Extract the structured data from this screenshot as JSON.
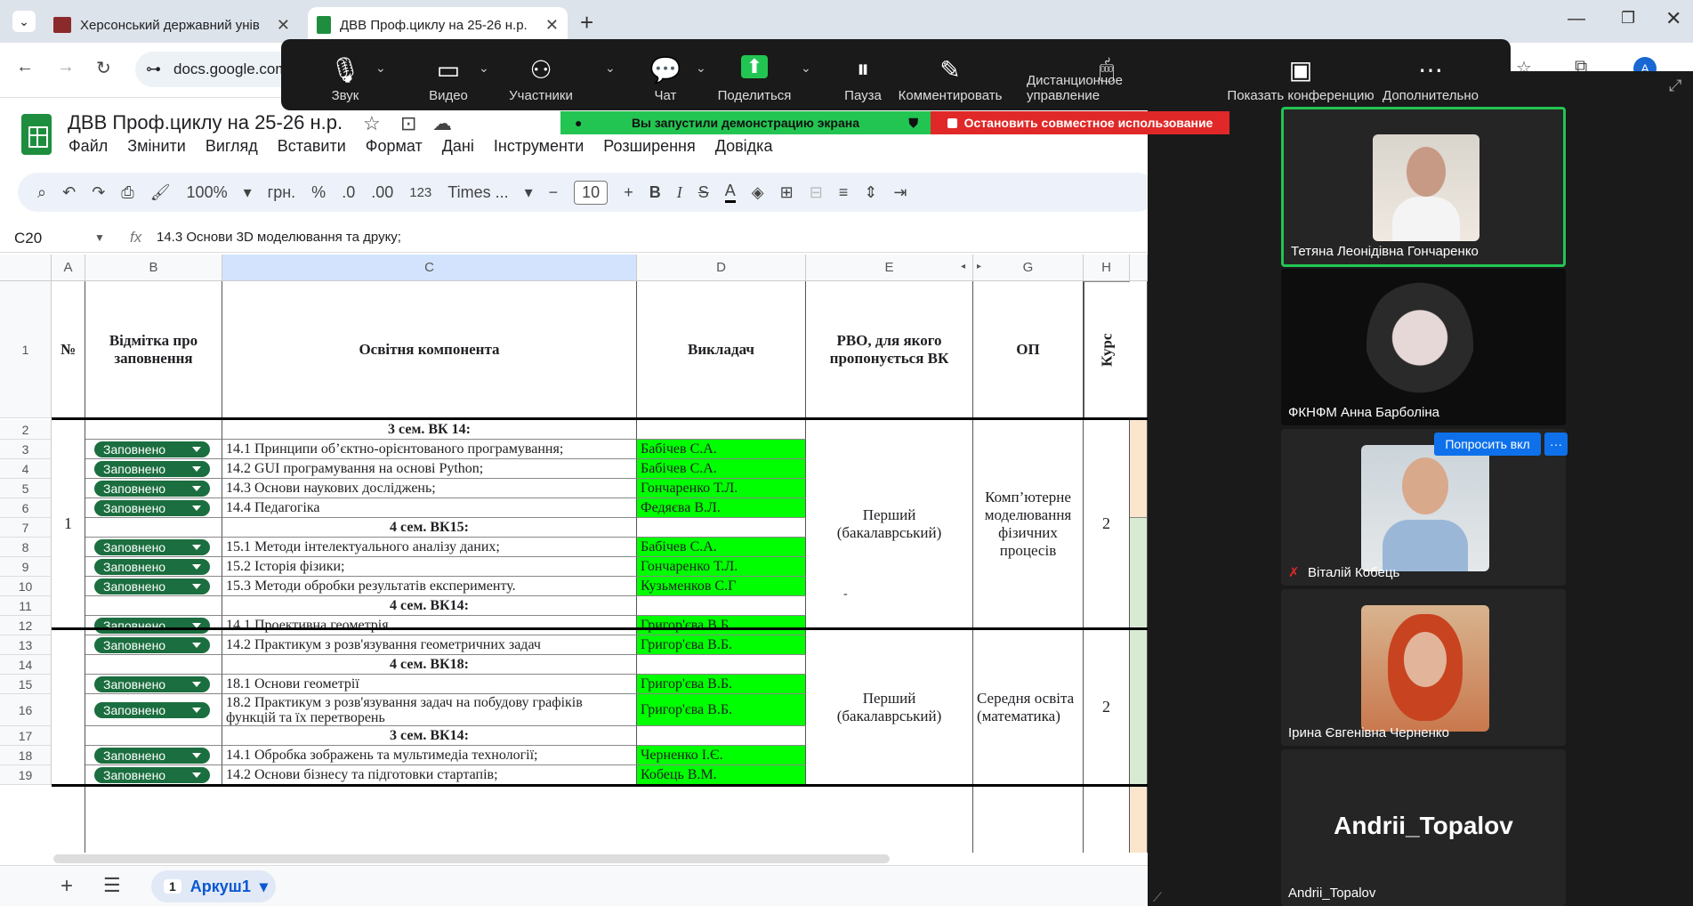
{
  "browser": {
    "tabs": [
      {
        "title": "Херсонський державний унів",
        "icon": "hksu-icon",
        "active": false
      },
      {
        "title": "ДВВ Проф.циклу на 25-26 н.р.",
        "icon": "sheets-icon",
        "active": true
      }
    ],
    "url": "docs.google.com",
    "profile_initial": "A"
  },
  "doc": {
    "title": "ДВВ Проф.циклу на 25-26 н.р.",
    "menu": [
      "Файл",
      "Змінити",
      "Вигляд",
      "Вставити",
      "Формат",
      "Дані",
      "Інструменти",
      "Розширення",
      "Довідка"
    ],
    "toolbar": {
      "zoom": "100%",
      "currency": "грн.",
      "percent": "%",
      "dec_dec": ".0",
      "dec_inc": ".00",
      "format": "123",
      "font": "Times ...",
      "font_size": "10"
    },
    "cell_ref": "C20",
    "formula": "14.3 Основи 3D моделювання та друку;",
    "columns": [
      "A",
      "B",
      "C",
      "D",
      "E",
      "",
      "G",
      "H"
    ],
    "header_row": {
      "A": "№",
      "B": "Відмітка про заповнення",
      "C": "Освітня компонента",
      "D": "Викладач",
      "E": "РВО, для якого пропонується ВК",
      "G": "ОП",
      "H": "Курс"
    },
    "rows": [
      {
        "n": "2",
        "C": "3 сем. ВК 14:",
        "bold": true
      },
      {
        "n": "3",
        "B": "Заповнено",
        "C": "14.1 Принципи об’єктно-орієнтованого програмування;",
        "D": "Бабічев С.А."
      },
      {
        "n": "4",
        "B": "Заповнено",
        "C": "14.2 GUI програмування на основі Python;",
        "D": "Бабічев С.А."
      },
      {
        "n": "5",
        "B": "Заповнено",
        "C": "14.3 Основи наукових досліджень;",
        "D": "Гончаренко Т.Л."
      },
      {
        "n": "6",
        "B": "Заповнено",
        "C": "14.4 Педагогіка",
        "D": "Федяєва В.Л."
      },
      {
        "n": "7",
        "C": "4 сем. ВК15:",
        "bold": true
      },
      {
        "n": "8",
        "B": "Заповнено",
        "C": "15.1 Методи інтелектуального аналізу даних;",
        "D": "Бабічев С.А."
      },
      {
        "n": "9",
        "B": "Заповнено",
        "C": "15.2 Історія фізики;",
        "D": "Гончаренко Т.Л."
      },
      {
        "n": "10",
        "B": "Заповнено",
        "C": "15.3 Методи обробки результатів експерименту.",
        "D": "Кузьменков С.Г"
      },
      {
        "n": "11",
        "C": "4 сем. ВК14:",
        "bold": true
      },
      {
        "n": "12",
        "B": "Заповнено",
        "C": "14.1 Проективна геометрія",
        "D": "Григор'єва В.Б."
      },
      {
        "n": "13",
        "B": "Заповнено",
        "C": "14.2 Практикум з розв'язування геометричних задач",
        "D": "Григор'єва В.Б."
      },
      {
        "n": "14",
        "C": "4 сем. ВК18:",
        "bold": true
      },
      {
        "n": "15",
        "B": "Заповнено",
        "C": "18.1 Основи геометрії",
        "D": "Григор'єва В.Б."
      },
      {
        "n": "16",
        "B": "Заповнено",
        "C": "18.2 Практикум з розв'язування задач на побудову графіків функцій та їх перетворень",
        "D": "Григор'єва В.Б."
      },
      {
        "n": "17",
        "C": "3 сем. ВК14:",
        "bold": true
      },
      {
        "n": "18",
        "B": "Заповнено",
        "C": "14.1 Обробка зображень та мультимедіа технології;",
        "D": "Черненко І.Є."
      },
      {
        "n": "19",
        "B": "Заповнено",
        "C": "14.2 Основи бізнесу та підготовки стартапів;",
        "D": "Кобець В.М."
      }
    ],
    "group1": {
      "A": "1",
      "E": "Перший (бакалаврський)",
      "G": "Комп’ютерне моделювання фізичних процесів",
      "H": "2",
      "dash": "-"
    },
    "group2": {
      "E": "Перший (бакалаврський)",
      "G": "Середня освіта (математика)",
      "H": "2"
    },
    "sheet_tab": {
      "index": "1",
      "name": "Аркуш1"
    }
  },
  "zoom": {
    "controls": [
      {
        "label": "Звук",
        "icon": "mic-icon"
      },
      {
        "label": "Видео",
        "icon": "camera-icon"
      },
      {
        "label": "Участники",
        "icon": "participants-icon"
      },
      {
        "label": "Чат",
        "icon": "chat-icon"
      },
      {
        "label": "Поделиться",
        "icon": "share-icon"
      },
      {
        "label": "Пауза",
        "icon": "pause-icon"
      },
      {
        "label": "Комментировать",
        "icon": "pen-icon"
      },
      {
        "label": "Дистанционное управление",
        "icon": "mouse-icon"
      },
      {
        "label": "Показать конференцию",
        "icon": "screen-icon"
      },
      {
        "label": "Дополнительно",
        "icon": "more-icon"
      }
    ],
    "share_banner": "Вы запустили демонстрацию экрана",
    "stop_banner": "Остановить совместное использование",
    "ask_button": "Попросить вкл",
    "more_button": "···",
    "participants": [
      "Тетяна Леонідівна Гончаренко",
      "ФКНФМ Анна Барболіна",
      "Віталій Кобець",
      "Ірина Євгенівна Черненко",
      "Andrii_Topalov"
    ],
    "big_name": "Andrii_Topalov",
    "colors": {
      "green": "#23c552",
      "red": "#e02828",
      "panel": "#1a1a1a",
      "chip": "#1b6e3f",
      "filled": "#00ff00"
    }
  }
}
